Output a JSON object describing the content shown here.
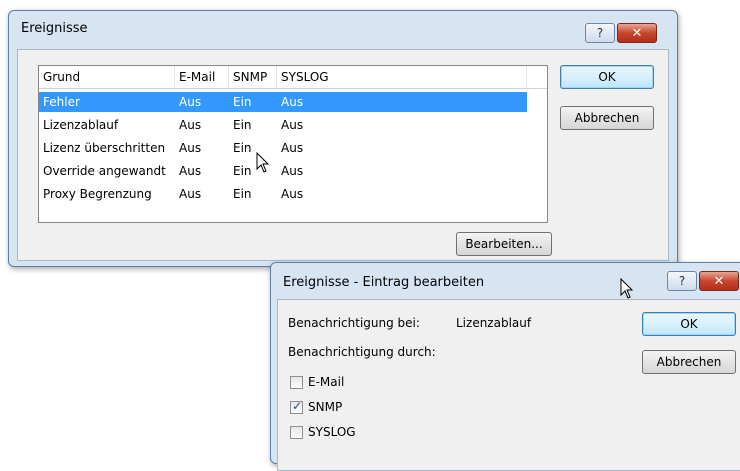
{
  "main_dialog": {
    "title": "Ereignisse",
    "help_label": "?",
    "close_label": "✕",
    "columns": [
      "Grund",
      "E-Mail",
      "SNMP",
      "SYSLOG"
    ],
    "rows": [
      {
        "grund": "Fehler",
        "email": "Aus",
        "snmp": "Ein",
        "syslog": "Aus",
        "selected": true
      },
      {
        "grund": "Lizenzablauf",
        "email": "Aus",
        "snmp": "Ein",
        "syslog": "Aus",
        "selected": false
      },
      {
        "grund": "Lizenz überschritten",
        "email": "Aus",
        "snmp": "Ein",
        "syslog": "Aus",
        "selected": false
      },
      {
        "grund": "Override angewandt",
        "email": "Aus",
        "snmp": "Ein",
        "syslog": "Aus",
        "selected": false
      },
      {
        "grund": "Proxy Begrenzung",
        "email": "Aus",
        "snmp": "Ein",
        "syslog": "Aus",
        "selected": false
      }
    ],
    "ok_label": "OK",
    "cancel_label": "Abbrechen",
    "edit_label": "Bearbeiten..."
  },
  "edit_dialog": {
    "title": "Ereignisse - Eintrag bearbeiten",
    "help_label": "?",
    "close_label": "✕",
    "notify_on_label": "Benachrichtigung bei:",
    "notify_on_value": "Lizenzablauf",
    "notify_via_label": "Benachrichtigung durch:",
    "options": [
      {
        "label": "E-Mail",
        "checked": false
      },
      {
        "label": "SNMP",
        "checked": true
      },
      {
        "label": "SYSLOG",
        "checked": false
      }
    ],
    "ok_label": "OK",
    "cancel_label": "Abbrechen"
  },
  "colors": {
    "selection": "#3399ff",
    "frame": "#d7e4f2",
    "close_button": "#c8462d"
  }
}
